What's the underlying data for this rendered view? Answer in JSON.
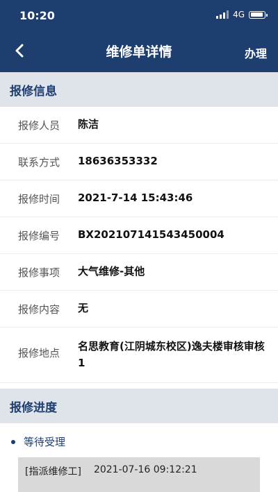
{
  "status_bar": {
    "time": "10:20",
    "network": "4G"
  },
  "nav": {
    "title": "维修单详情",
    "action_label": "办理"
  },
  "repair_info": {
    "section_title": "报修信息",
    "rows": [
      {
        "label": "报修人员",
        "value": "陈洁"
      },
      {
        "label": "联系方式",
        "value": "18636353332"
      },
      {
        "label": "报修时间",
        "value": "2021-7-14 15:43:46"
      },
      {
        "label": "报修编号",
        "value": "BX202107141543450004"
      },
      {
        "label": "报修事项",
        "value": "大气维修-其他"
      },
      {
        "label": "报修内容",
        "value": "无"
      },
      {
        "label": "报修地点",
        "value": "名思教育(江阴城东校区)逸夫楼审核审核1"
      }
    ]
  },
  "progress": {
    "section_title": "报修进度",
    "steps": [
      {
        "status": "等待受理",
        "action": "[指派维修工]",
        "time": "2021-07-16 09:12:21"
      }
    ]
  }
}
